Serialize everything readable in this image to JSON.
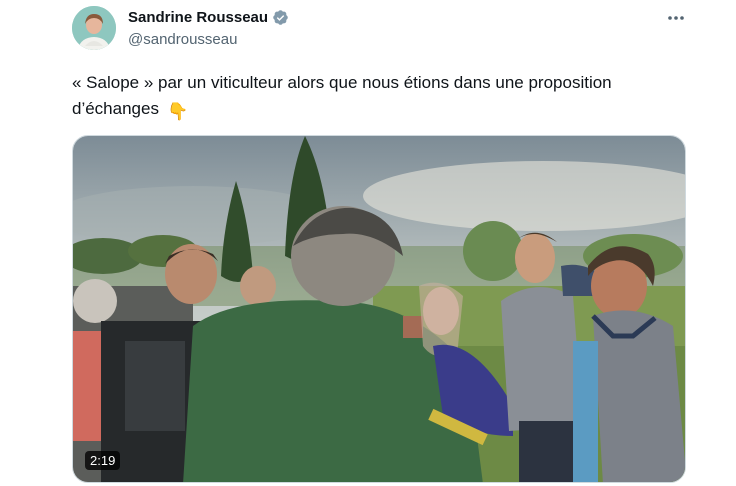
{
  "author": {
    "display_name": "Sandrine Rousseau",
    "handle": "@sandrousseau",
    "verified": true,
    "verified_color": "#829aab"
  },
  "tweet": {
    "text": "« Salope » par un viticulteur alors que nous étions dans une proposition d’échanges",
    "emoji": "👇",
    "more_icon": "more-horizontal-icon"
  },
  "media": {
    "type": "video",
    "duration": "2:19"
  }
}
